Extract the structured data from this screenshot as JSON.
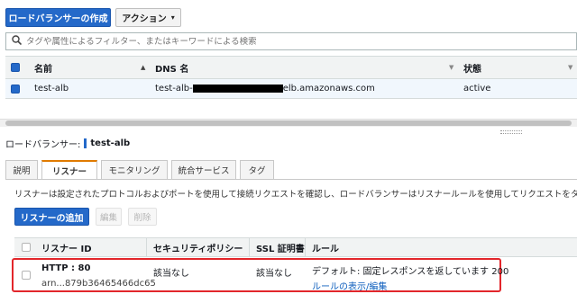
{
  "toolbar": {
    "create_label": "ロードバランサーの作成",
    "actions_label": "アクション"
  },
  "search": {
    "placeholder": "タグや属性によるフィルター、またはキーワードによる検索"
  },
  "lb_table": {
    "headers": {
      "name": "名前",
      "dns": "DNS 名",
      "state": "状態"
    },
    "rows": [
      {
        "name": "test-alb",
        "dns_prefix": "test-alb-",
        "dns_suffix": "elb.amazonaws.com",
        "state": "active"
      }
    ]
  },
  "detail": {
    "label": "ロードバランサー:",
    "name": "test-alb",
    "tabs": [
      "説明",
      "リスナー",
      "モニタリング",
      "統合サービス",
      "タグ"
    ],
    "active_tab": 1,
    "description": "リスナーは設定されたプロトコルおよびポートを使用して接続リクエストを確認し、ロードバランサーはリスナールールを使用してリクエストをタ",
    "add_listener_label": "リスナーの追加",
    "edit_label": "編集",
    "delete_label": "削除"
  },
  "listener_table": {
    "headers": [
      "リスナー ID",
      "セキュリティポリシー",
      "SSL 証明書",
      "ルール"
    ],
    "rows": [
      {
        "id": "HTTP : 80",
        "arn": "arn...879b36465466dc65",
        "security_policy": "該当なし",
        "ssl_cert": "該当なし",
        "rule": "デフォルト: 固定レスポンスを返しています 200",
        "rule_link": "ルールの表示/編集"
      }
    ]
  },
  "colors": {
    "primary": "#2469c9",
    "active_tab": "#e07b00",
    "highlight_border": "#e2262b",
    "link": "#0d5ebd"
  }
}
